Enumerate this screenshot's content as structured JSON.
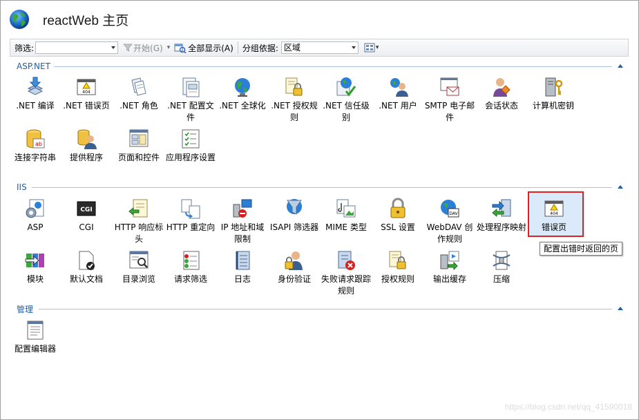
{
  "page": {
    "title": "reactWeb 主页"
  },
  "toolbar": {
    "filter_label": "筛选:",
    "filter_value": "",
    "start_label": "开始(G)",
    "show_all_label": "全部显示(A)",
    "group_by_label": "分组依据:",
    "group_by_value": "区域"
  },
  "sections": {
    "aspnet": {
      "title": "ASP.NET",
      "items": [
        ".NET 编译",
        ".NET 错误页",
        ".NET 角色",
        ".NET 配置文件",
        ".NET 全球化",
        ".NET 授权规则",
        ".NET 信任级别",
        ".NET 用户",
        "SMTP 电子邮件",
        "会话状态",
        "计算机密钥",
        "连接字符串",
        "提供程序",
        "页面和控件",
        "应用程序设置"
      ]
    },
    "iis": {
      "title": "IIS",
      "items": [
        "ASP",
        "CGI",
        "HTTP 响应标头",
        "HTTP 重定向",
        "IP 地址和域限制",
        "ISAPI 筛选器",
        "MIME 类型",
        "SSL 设置",
        "WebDAV 创作规则",
        "处理程序映射",
        "错误页",
        "模块",
        "默认文档",
        "目录浏览",
        "请求筛选",
        "日志",
        "身份验证",
        "失败请求跟踪规则",
        "授权规则",
        "输出缓存",
        "压缩"
      ]
    },
    "management": {
      "title": "管理",
      "items": [
        "配置编辑器"
      ]
    }
  },
  "tooltip": "配置出错时返回的页",
  "watermark": "https://blog.csdn.net/qq_41590018"
}
